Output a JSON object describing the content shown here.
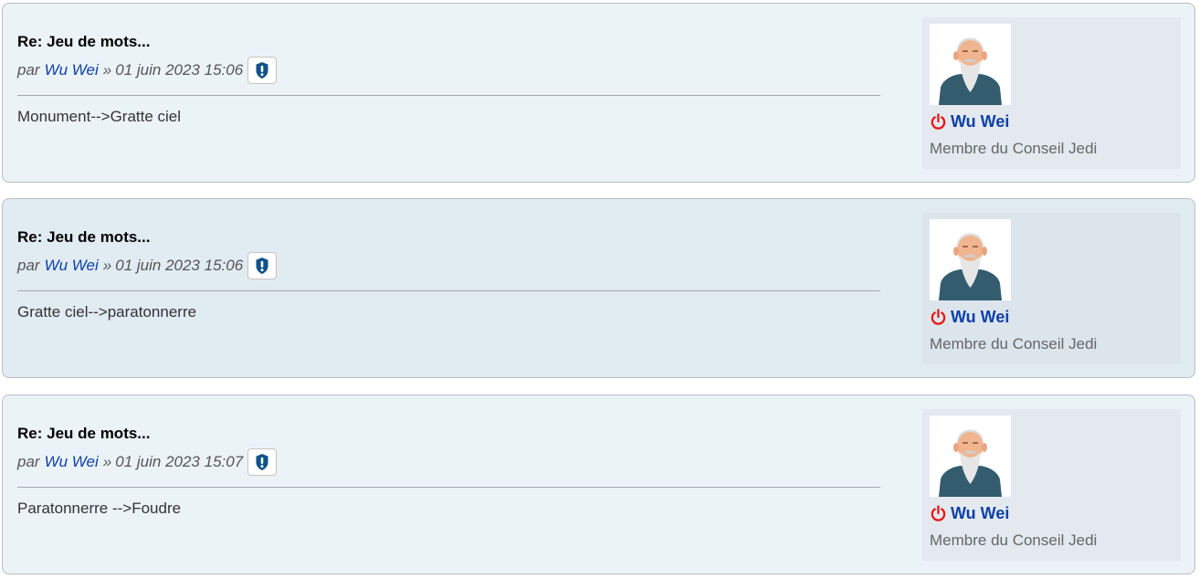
{
  "posts": [
    {
      "title": "Re: Jeu de mots...",
      "by_label": "par",
      "author": "Wu Wei",
      "separator": "»",
      "date": "01 juin 2023 15:06",
      "content": "Monument-->Gratte ciel",
      "profile": {
        "username": "Wu Wei",
        "rank": "Membre du Conseil Jedi"
      }
    },
    {
      "title": "Re: Jeu de mots...",
      "by_label": "par",
      "author": "Wu Wei",
      "separator": "»",
      "date": "01 juin 2023 15:06",
      "content": "Gratte ciel-->paratonnerre",
      "profile": {
        "username": "Wu Wei",
        "rank": "Membre du Conseil Jedi"
      }
    },
    {
      "title": "Re: Jeu de mots...",
      "by_label": "par",
      "author": "Wu Wei",
      "separator": "»",
      "date": "01 juin 2023 15:07",
      "content": "Paratonnerre -->Foudre",
      "profile": {
        "username": "Wu Wei",
        "rank": "Membre du Conseil Jedi"
      }
    }
  ],
  "icons": {
    "report": "exclamation-shield-icon",
    "status": "power-icon",
    "avatar": "bearded-sage-avatar"
  },
  "colors": {
    "link": "#0c40a8",
    "offline_status": "#e81414",
    "report_icon": "#105289",
    "post_bg": "#ecf3f7",
    "post_bg_alt": "#e1ebf2"
  }
}
